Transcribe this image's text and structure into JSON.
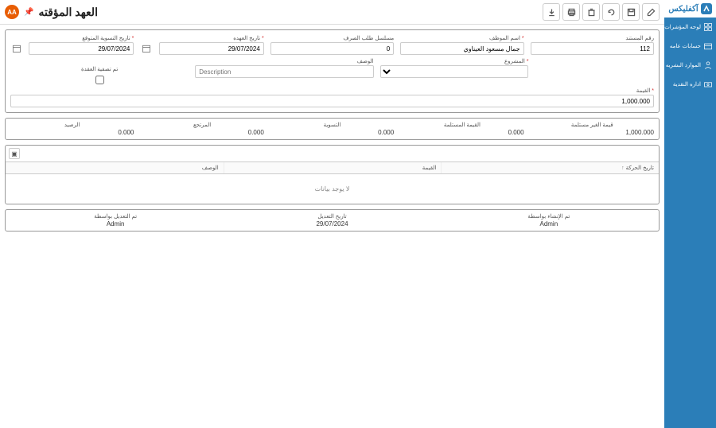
{
  "brand": "آكفليكس",
  "sidebar": {
    "items": [
      {
        "label": "لوحه المؤشرات"
      },
      {
        "label": "حسابات عامه"
      },
      {
        "label": "الموارد البشريه"
      },
      {
        "label": "اداره النقدية"
      }
    ]
  },
  "toolbar": {
    "title": "العهد المؤقته",
    "avatar": "AA"
  },
  "form": {
    "doc_no_label": "رقم المستند",
    "doc_no_value": "112",
    "employee_label": "اسم الموظف",
    "employee_value": "جمال مسعود العيناوي",
    "serial_label": "مسلسل طلب الصرف",
    "serial_value": "0",
    "custody_date_label": "تاريخ العهده",
    "custody_date_value": "29/07/2024",
    "expected_settle_label": "تاريخ التسوية المتوقع",
    "expected_settle_value": "29/07/2024",
    "desc_label": "الوصف",
    "desc_placeholder": "Description",
    "project_label": "المشروع",
    "closed_label": "تم تصفية العقدة",
    "amount_label": "القيمة",
    "amount_value": "1,000.000"
  },
  "totals": {
    "unset_label": "قيمة الغير مستلمة",
    "unset_value": "1,000.000",
    "received_label": "القيمة المستلمة",
    "received_value": "0.000",
    "settlement_label": "التسوية",
    "settlement_value": "0.000",
    "returned_label": "المرتجع",
    "returned_value": "0.000",
    "balance_label": "الرصيد",
    "balance_value": "0.000"
  },
  "grid": {
    "col_date": "تاريخ الحركة",
    "col_amount": "القيمة",
    "col_desc": "الوصف",
    "empty": "لا يوجد بيانات"
  },
  "audit": {
    "created_by_label": "تم الإنشاء بواسطة",
    "created_by_value": "Admin",
    "mod_date_label": "تاريخ التعديل",
    "mod_date_value": "29/07/2024",
    "mod_by_label": "تم التعديل بواسطة",
    "mod_by_value": "Admin"
  }
}
